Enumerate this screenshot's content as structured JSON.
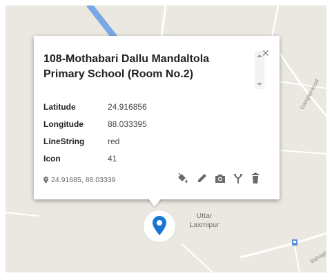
{
  "popup": {
    "title": "108-Mothabari Dallu Mandaltola Primary School (Room No.2)",
    "close_icon": "close-icon",
    "attributes": [
      {
        "name": "Latitude",
        "value": "24.916856"
      },
      {
        "name": "Longitude",
        "value": "88.033395"
      },
      {
        "name": "LineString",
        "value": "red"
      },
      {
        "name": "Icon",
        "value": "41"
      }
    ],
    "coordinates": "24.91685, 88.03339",
    "toolbar": {
      "style": "paint-bucket-icon",
      "edit": "pencil-icon",
      "photo": "camera-icon",
      "directions": "fork-directions-icon",
      "delete": "trash-icon"
    }
  },
  "map": {
    "place_label": "Uttar\nLaxmipur",
    "road_labels": [
      "Gangaprasad",
      "Bahagour"
    ],
    "marker_color": "#1976d2"
  }
}
